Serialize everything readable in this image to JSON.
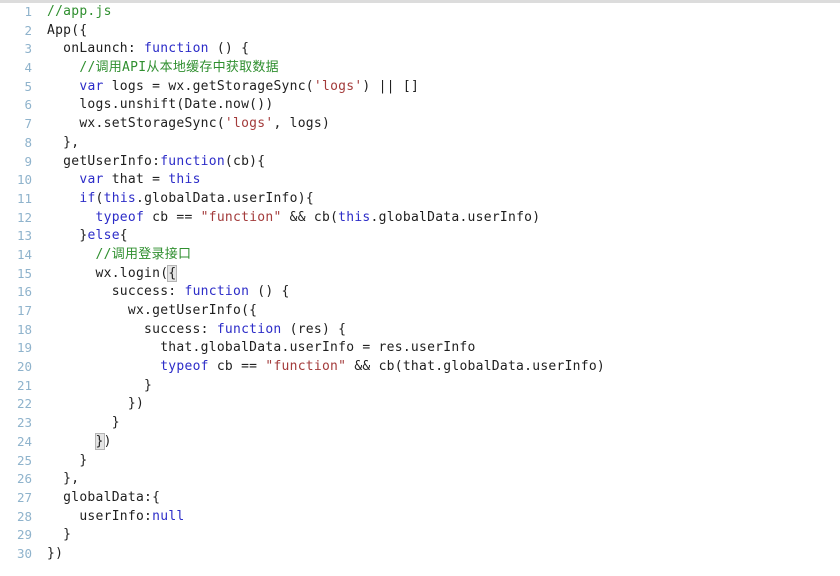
{
  "editor": {
    "file_name": "app.js",
    "language": "javascript",
    "total_lines": 30,
    "first_visible_line": 1,
    "colors": {
      "background": "#ffffff",
      "gutter_text": "#8fb3cc",
      "plain_text": "#202020",
      "comment": "#2f8f2f",
      "keyword": "#2c2cc8",
      "string": "#a33b3b",
      "literal": "#2c2cc8",
      "bracket_match_bg": "#e4e4e4",
      "top_rule": "#dcdcdc"
    }
  },
  "lines": [
    {
      "number": "1",
      "tokens": [
        {
          "text": "//app.js",
          "type": "comment"
        }
      ]
    },
    {
      "number": "2",
      "tokens": [
        {
          "text": "App({",
          "type": "plain"
        }
      ]
    },
    {
      "number": "3",
      "tokens": [
        {
          "text": "  onLaunch: ",
          "type": "plain"
        },
        {
          "text": "function",
          "type": "keyword"
        },
        {
          "text": " () {",
          "type": "plain"
        }
      ]
    },
    {
      "number": "4",
      "tokens": [
        {
          "text": "    ",
          "type": "plain"
        },
        {
          "text": "//调用API从本地缓存中获取数据",
          "type": "comment"
        }
      ]
    },
    {
      "number": "5",
      "tokens": [
        {
          "text": "    ",
          "type": "plain"
        },
        {
          "text": "var",
          "type": "keyword"
        },
        {
          "text": " logs = wx.getStorageSync(",
          "type": "plain"
        },
        {
          "text": "'logs'",
          "type": "string"
        },
        {
          "text": ") || []",
          "type": "plain"
        }
      ]
    },
    {
      "number": "6",
      "tokens": [
        {
          "text": "    logs.unshift(Date.now())",
          "type": "plain"
        }
      ]
    },
    {
      "number": "7",
      "tokens": [
        {
          "text": "    wx.setStorageSync(",
          "type": "plain"
        },
        {
          "text": "'logs'",
          "type": "string"
        },
        {
          "text": ", logs)",
          "type": "plain"
        }
      ]
    },
    {
      "number": "8",
      "tokens": [
        {
          "text": "  },",
          "type": "plain"
        }
      ]
    },
    {
      "number": "9",
      "tokens": [
        {
          "text": "  getUserInfo:",
          "type": "plain"
        },
        {
          "text": "function",
          "type": "keyword"
        },
        {
          "text": "(cb){",
          "type": "plain"
        }
      ]
    },
    {
      "number": "10",
      "tokens": [
        {
          "text": "    ",
          "type": "plain"
        },
        {
          "text": "var",
          "type": "keyword"
        },
        {
          "text": " that = ",
          "type": "plain"
        },
        {
          "text": "this",
          "type": "this"
        }
      ]
    },
    {
      "number": "11",
      "tokens": [
        {
          "text": "    ",
          "type": "plain"
        },
        {
          "text": "if",
          "type": "keyword"
        },
        {
          "text": "(",
          "type": "plain"
        },
        {
          "text": "this",
          "type": "this"
        },
        {
          "text": ".globalData.userInfo){",
          "type": "plain"
        }
      ]
    },
    {
      "number": "12",
      "tokens": [
        {
          "text": "      ",
          "type": "plain"
        },
        {
          "text": "typeof",
          "type": "keyword"
        },
        {
          "text": " cb == ",
          "type": "plain"
        },
        {
          "text": "\"function\"",
          "type": "string"
        },
        {
          "text": " && cb(",
          "type": "plain"
        },
        {
          "text": "this",
          "type": "this"
        },
        {
          "text": ".globalData.userInfo)",
          "type": "plain"
        }
      ]
    },
    {
      "number": "13",
      "tokens": [
        {
          "text": "    }",
          "type": "plain"
        },
        {
          "text": "else",
          "type": "keyword"
        },
        {
          "text": "{",
          "type": "plain"
        }
      ]
    },
    {
      "number": "14",
      "tokens": [
        {
          "text": "      ",
          "type": "plain"
        },
        {
          "text": "//调用登录接口",
          "type": "comment"
        }
      ]
    },
    {
      "number": "15",
      "tokens": [
        {
          "text": "      wx.login(",
          "type": "plain"
        },
        {
          "text": "{",
          "type": "plain",
          "bracket_match": true
        }
      ]
    },
    {
      "number": "16",
      "tokens": [
        {
          "text": "        success: ",
          "type": "plain"
        },
        {
          "text": "function",
          "type": "keyword"
        },
        {
          "text": " () {",
          "type": "plain"
        }
      ]
    },
    {
      "number": "17",
      "tokens": [
        {
          "text": "          wx.getUserInfo({",
          "type": "plain"
        }
      ]
    },
    {
      "number": "18",
      "tokens": [
        {
          "text": "            success: ",
          "type": "plain"
        },
        {
          "text": "function",
          "type": "keyword"
        },
        {
          "text": " (res) {",
          "type": "plain"
        }
      ]
    },
    {
      "number": "19",
      "tokens": [
        {
          "text": "              that.globalData.userInfo = res.userInfo",
          "type": "plain"
        }
      ]
    },
    {
      "number": "20",
      "tokens": [
        {
          "text": "              ",
          "type": "plain"
        },
        {
          "text": "typeof",
          "type": "keyword"
        },
        {
          "text": " cb == ",
          "type": "plain"
        },
        {
          "text": "\"function\"",
          "type": "string"
        },
        {
          "text": " && cb(that.globalData.userInfo)",
          "type": "plain"
        }
      ]
    },
    {
      "number": "21",
      "tokens": [
        {
          "text": "            }",
          "type": "plain"
        }
      ]
    },
    {
      "number": "22",
      "tokens": [
        {
          "text": "          })",
          "type": "plain"
        }
      ]
    },
    {
      "number": "23",
      "tokens": [
        {
          "text": "        }",
          "type": "plain"
        }
      ]
    },
    {
      "number": "24",
      "tokens": [
        {
          "text": "      ",
          "type": "plain"
        },
        {
          "text": "}",
          "type": "plain",
          "bracket_match": true
        },
        {
          "text": ")",
          "type": "plain"
        }
      ]
    },
    {
      "number": "25",
      "tokens": [
        {
          "text": "    }",
          "type": "plain"
        }
      ]
    },
    {
      "number": "26",
      "tokens": [
        {
          "text": "  },",
          "type": "plain"
        }
      ]
    },
    {
      "number": "27",
      "tokens": [
        {
          "text": "  globalData:{",
          "type": "plain"
        }
      ]
    },
    {
      "number": "28",
      "tokens": [
        {
          "text": "    userInfo:",
          "type": "plain"
        },
        {
          "text": "null",
          "type": "literal"
        }
      ]
    },
    {
      "number": "29",
      "tokens": [
        {
          "text": "  }",
          "type": "plain"
        }
      ]
    },
    {
      "number": "30",
      "tokens": [
        {
          "text": "})",
          "type": "plain"
        }
      ]
    }
  ]
}
